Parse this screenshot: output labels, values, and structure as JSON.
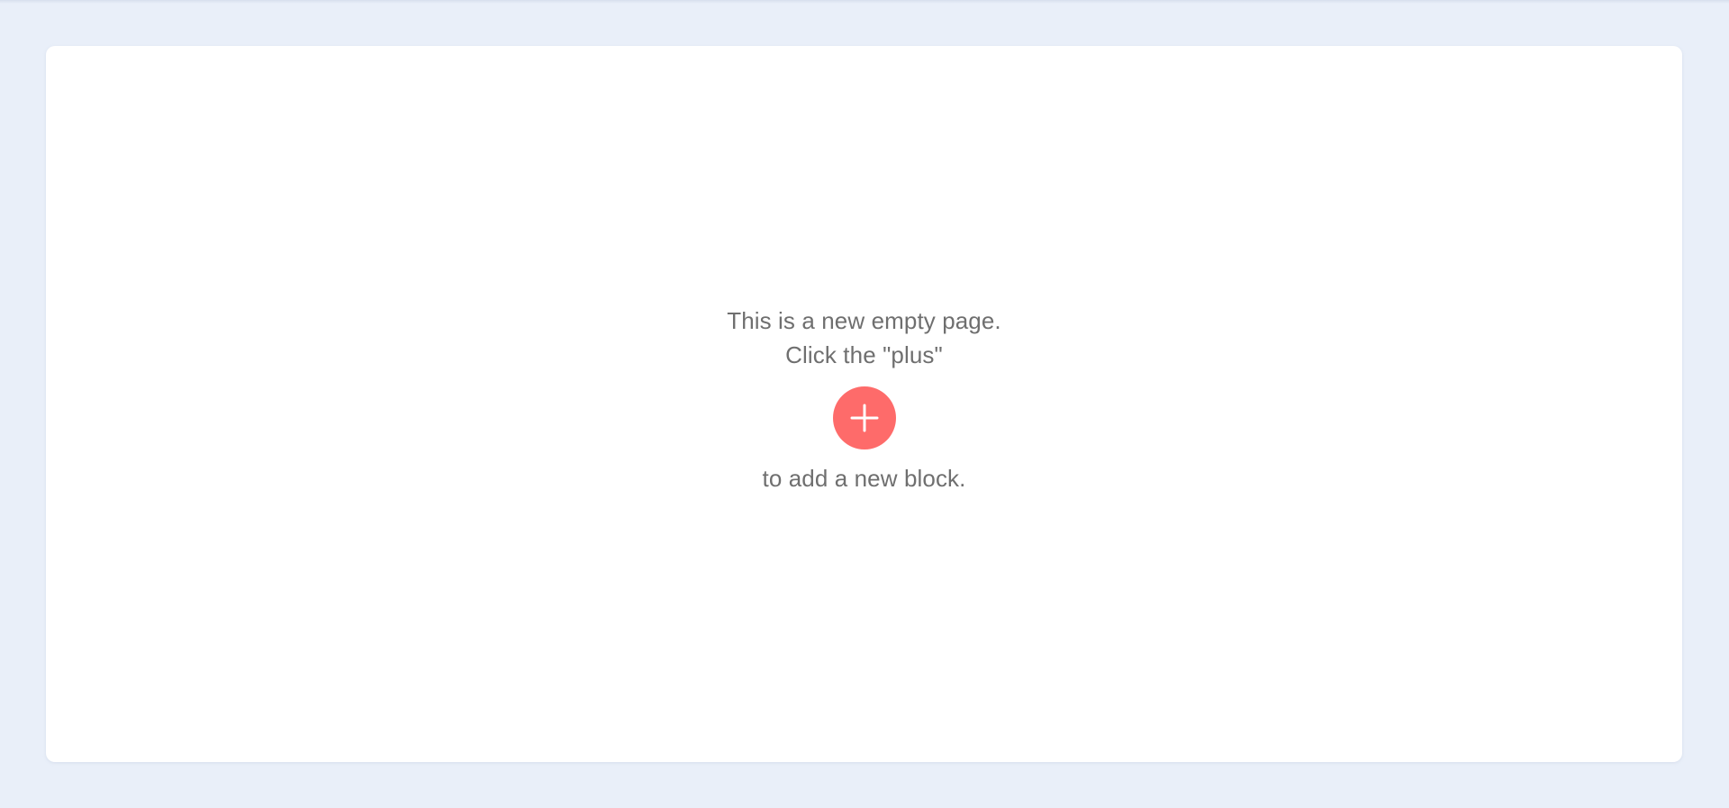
{
  "empty_state": {
    "line_1": "This is a new empty page.",
    "line_2": "Click the \"plus\"",
    "line_3": "to add a new block.",
    "add_button_icon": "plus-icon"
  },
  "colors": {
    "background": "#e9eff9",
    "card": "#ffffff",
    "text": "#6f6f6f",
    "accent": "#fe6b6a"
  }
}
